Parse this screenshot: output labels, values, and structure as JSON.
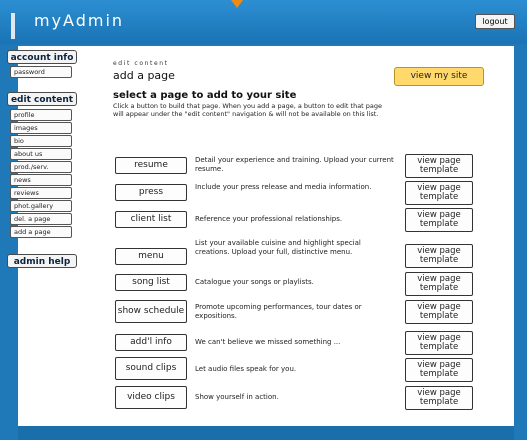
{
  "header": {
    "app_title": "myAdmin",
    "logout_label": "logout"
  },
  "sidebar": {
    "account_info": "account info",
    "account_items": [
      "password"
    ],
    "edit_content": "edit content",
    "edit_items": [
      "profile",
      "images",
      "bio",
      "about us",
      "prod./serv.",
      "news",
      "reviews",
      "phot.gallery",
      "del. a page",
      "add a page"
    ],
    "admin_help": "admin help"
  },
  "main": {
    "kicker": "edit content",
    "page_title": "add a page",
    "view_site_label": "view my site",
    "heading": "select a page to add to your site",
    "intro": "Click a button to build that page. When you add a page, a button to edit that page will appear under the \"edit content\" navigation & will not be available on this list.",
    "template_label": "view page template",
    "rows": [
      {
        "label": "resume",
        "desc": "Detail your experience and training. Upload your current resume."
      },
      {
        "label": "press",
        "desc": "Include your press release and media information."
      },
      {
        "label": "client list",
        "desc": "Reference your professional relationships."
      },
      {
        "label": "menu",
        "desc": "List your available cuisine and highlight special creations. Upload your full, distinctive menu."
      },
      {
        "label": "song list",
        "desc": "Catalogue your songs or playlists."
      },
      {
        "label": "show schedule",
        "desc": "Promote upcoming performances, tour dates or expositions."
      },
      {
        "label": "add'l info",
        "desc": "We can't believe we missed something ..."
      },
      {
        "label": "sound clips",
        "desc": "Let audio files speak for you."
      },
      {
        "label": "video clips",
        "desc": "Show yourself in action."
      }
    ]
  }
}
